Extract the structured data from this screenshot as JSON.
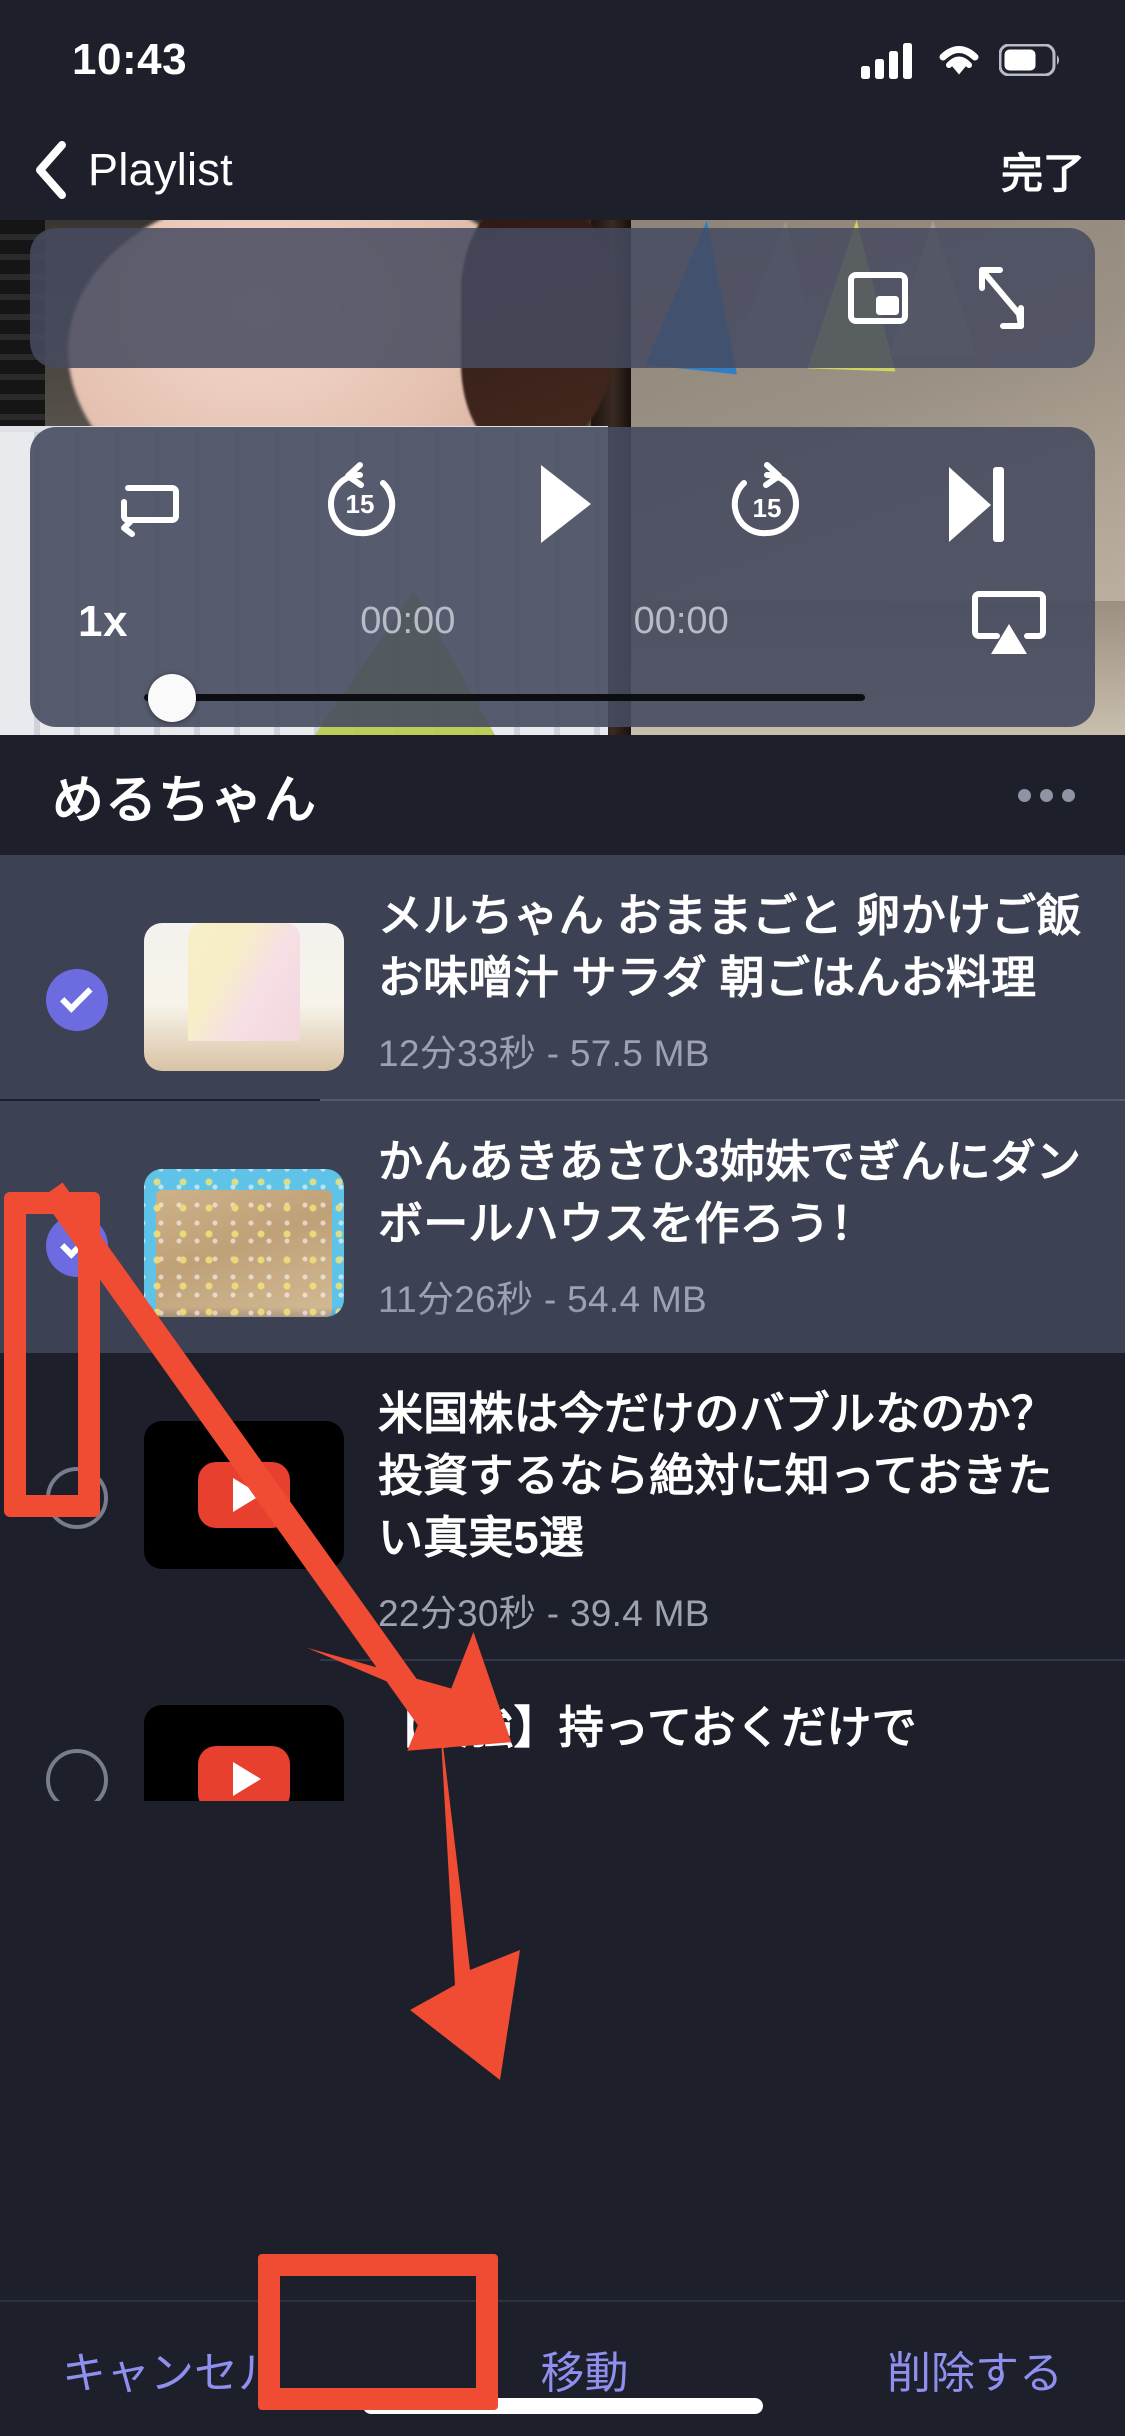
{
  "status_bar": {
    "time": "10:43",
    "icons": [
      "cellular-signal-icon",
      "wifi-icon",
      "battery-icon"
    ]
  },
  "nav_bar": {
    "back_icon": "chevron-left-icon",
    "back_label": "Playlist",
    "done_label": "完了"
  },
  "player": {
    "top_controls": [
      {
        "name": "picture-in-picture-icon"
      },
      {
        "name": "expand-fullscreen-icon"
      }
    ],
    "transport_controls": [
      {
        "name": "repeat-icon"
      },
      {
        "name": "rewind-15-icon",
        "label": "15"
      },
      {
        "name": "play-icon"
      },
      {
        "name": "forward-15-icon",
        "label": "15"
      },
      {
        "name": "skip-next-icon"
      }
    ],
    "speed_label": "1x",
    "elapsed_time": "00:00",
    "total_time": "00:00",
    "airplay_icon": "airplay-icon",
    "seek_progress_percent": 0
  },
  "playlist": {
    "title": "めるちゃん",
    "more_icon": "more-horizontal-icon",
    "items": [
      {
        "title": "メルちゃん おままごと 卵かけご飯 お味噌汁 サラダ 朝ごはんお料理",
        "meta": "12分33秒 - 57.5 MB",
        "selected": true,
        "thumbnail": "child-playing-thumbnail"
      },
      {
        "title": "かんあきあさひ3姉妹でぎんにダンボールハウスを作ろう！",
        "meta": "11分26秒 - 54.4 MB",
        "selected": true,
        "thumbnail": "cardboard-house-thumbnail"
      },
      {
        "title": "米国株は今だけのバブルなのか？投資するなら絶対に知っておきたい真実5選",
        "meta": "22分30秒 - 39.4 MB",
        "selected": false,
        "thumbnail": "youtube-play-thumbnail"
      },
      {
        "title": "【最強】持っておくだけで",
        "meta": "",
        "selected": false,
        "thumbnail": "youtube-play-thumbnail"
      }
    ]
  },
  "toolbar": {
    "cancel_label": "キャンセル",
    "move_label": "移動",
    "delete_label": "削除する",
    "accent_color": "#8f8fef"
  },
  "annotations": {
    "highlight_color": "#f04b33",
    "boxes": [
      "selection-checkboxes-highlight",
      "move-button-highlight"
    ],
    "arrow": "arrow-from-checkboxes-to-move-button"
  },
  "theme": {
    "background": "#1d1f2b",
    "selected_row": "#3c4153",
    "checkbox_on": "#6c6ce0",
    "muted_text": "#9ea2b0"
  }
}
